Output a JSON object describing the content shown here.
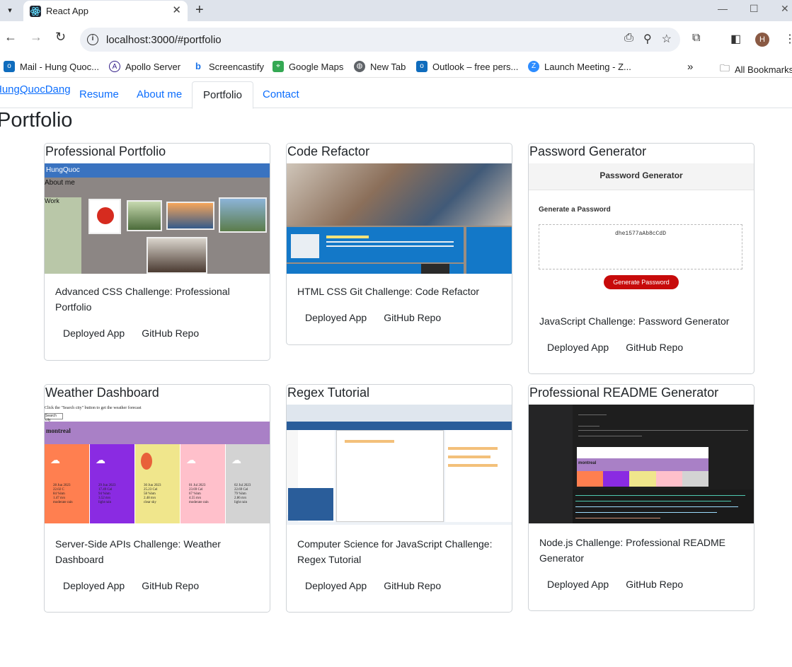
{
  "browser": {
    "tab_title": "React App",
    "url": "localhost:3000/#portfolio",
    "profile_initial": "H",
    "bookmarks": [
      {
        "label": "Mail - Hung Quoc...",
        "icon": "outlook-icon",
        "color": "#0f6cbd"
      },
      {
        "label": "Apollo Server",
        "icon": "apollo-icon",
        "color": "#311c87"
      },
      {
        "label": "Screencastify",
        "icon": "screencastify-icon",
        "color": "#1a73e8"
      },
      {
        "label": "Google Maps",
        "icon": "maps-icon",
        "color": "#34a853"
      },
      {
        "label": "New Tab",
        "icon": "globe-icon",
        "color": "#5f6368"
      },
      {
        "label": "Outlook – free pers...",
        "icon": "outlook-icon",
        "color": "#0f6cbd"
      },
      {
        "label": "Launch Meeting - Z...",
        "icon": "zoom-icon",
        "color": "#2d8cff"
      }
    ],
    "all_bookmarks": "All Bookmarks"
  },
  "site": {
    "brand": "HungQuocDang",
    "nav": [
      {
        "label": "Resume",
        "active": false
      },
      {
        "label": "About me",
        "active": false
      },
      {
        "label": "Portfolio",
        "active": true
      },
      {
        "label": "Contact",
        "active": false
      }
    ],
    "page_title": "Portfolio",
    "projects": [
      {
        "title": "Professional Portfolio",
        "description": "Advanced CSS Challenge: Professional Portfolio",
        "deployed": "Deployed App",
        "repo": "GitHub Repo"
      },
      {
        "title": "Code Refactor",
        "description": "HTML CSS Git Challenge: Code Refactor",
        "deployed": "Deployed App",
        "repo": "GitHub Repo"
      },
      {
        "title": "Password Generator",
        "description": "JavaScript Challenge: Password Generator",
        "deployed": "Deployed App",
        "repo": "GitHub Repo"
      },
      {
        "title": "Weather Dashboard",
        "description": "Server-Side APIs Challenge: Weather Dashboard",
        "deployed": "Deployed App",
        "repo": "GitHub Repo"
      },
      {
        "title": "Regex Tutorial",
        "description": "Computer Science for JavaScript Challenge: Regex Tutorial",
        "deployed": "Deployed App",
        "repo": "GitHub Repo"
      },
      {
        "title": "Professional README Generator",
        "description": "Node.js Challenge: Professional README Generator",
        "deployed": "Deployed App",
        "repo": "GitHub Repo"
      }
    ]
  },
  "thumbnails": {
    "portfolio": {
      "brand": "HungQuoc",
      "about": "About me",
      "work": "Work"
    },
    "password": {
      "header": "Password Generator",
      "subheader": "Generate a Password",
      "password": "dhe1577aAb8cCdD",
      "button": "Generate Password"
    },
    "weather": {
      "prompt": "Click the \"Search city\" button to get the weather forecast",
      "search_button": "Search city",
      "city": "montreal",
      "days": [
        {
          "lines": [
            "28 Jun 2023",
            "22.02 C",
            "84 %hm",
            "1.47 m/s",
            "moderate rain"
          ],
          "color": "#ff7f50"
        },
        {
          "lines": [
            "29 Jun 2023",
            "17.49 Cel",
            "94 %hm",
            "3.52 m/s",
            "light rain"
          ],
          "color": "#8a2be2"
        },
        {
          "lines": [
            "30 Jun 2023",
            "25.23 Cel",
            "58 %hm",
            "2.48 m/s",
            "clear sky"
          ],
          "color": "#f0e68c"
        },
        {
          "lines": [
            "01 Jul 2023",
            "23.69 Cel",
            "67 %hm",
            "4.55 m/s",
            "moderate rain"
          ],
          "color": "#ffc0cb"
        },
        {
          "lines": [
            "02 Jul 2023",
            "22.69 Cel",
            "79 %hm",
            "2.86 m/s",
            "light rain"
          ],
          "color": "#d3d3d3"
        }
      ]
    },
    "readme": {
      "city": "montreal"
    }
  }
}
